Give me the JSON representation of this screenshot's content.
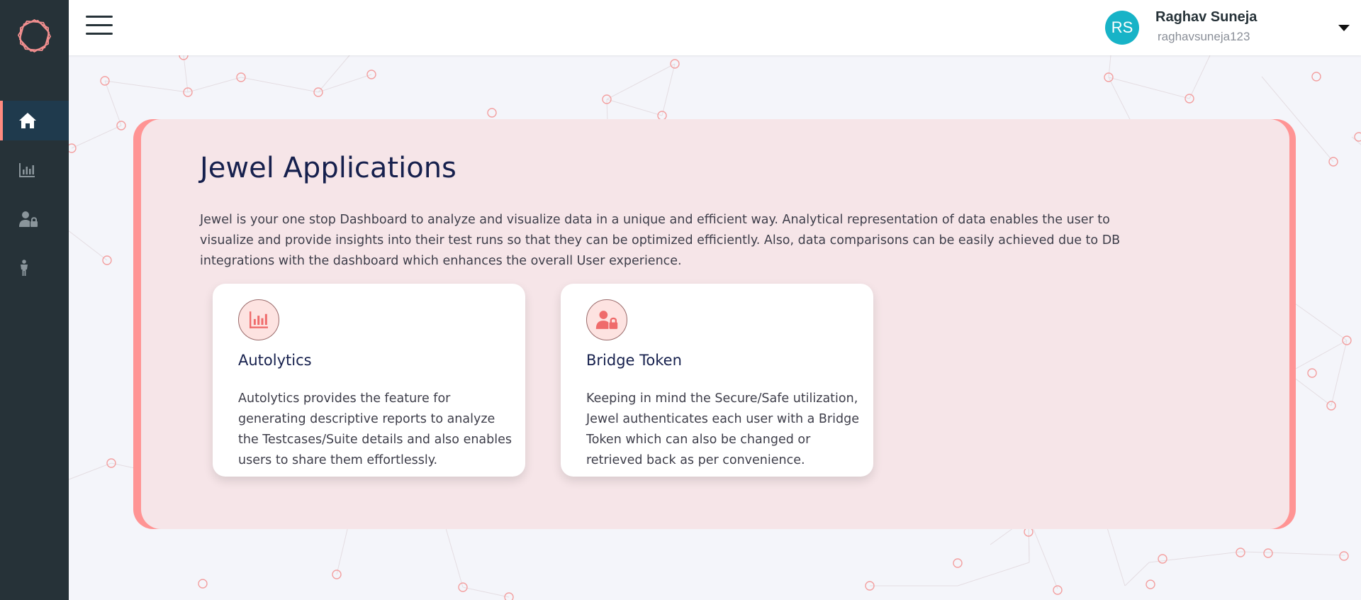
{
  "sidebar": {
    "logo_icon": "hexagon-network-logo-icon",
    "items": [
      {
        "icon": "home-icon",
        "active": true
      },
      {
        "icon": "bar-chart-icon",
        "active": false
      },
      {
        "icon": "user-lock-icon",
        "active": false
      },
      {
        "icon": "person-standing-icon",
        "active": false
      }
    ]
  },
  "header": {
    "menu_icon": "hamburger-menu-icon",
    "user": {
      "initials": "RS",
      "name": "Raghav Suneja",
      "handle": "raghavsuneja123",
      "dropdown_icon": "caret-down-icon"
    }
  },
  "main": {
    "title": "Jewel Applications",
    "description": "Jewel is your one stop Dashboard to analyze and visualize data in a unique and efficient way. Analytical representation of data enables the user to visualize and provide insights into their test runs so that they can be optimized efficiently. Also, data comparisons can be easily achieved due to DB integrations with the dashboard which enhances the overall User experience.",
    "cards": [
      {
        "icon": "bar-chart-icon",
        "title": "Autolytics",
        "description": "Autolytics provides the feature for generating descriptive reports to analyze the Testcases/Suite details and also enables users to share them effortlessly."
      },
      {
        "icon": "user-lock-icon",
        "title": "Bridge Token",
        "description": "Keeping in mind the Secure/Safe utilization, Jewel authenticates each user with a Bridge Token which can also be changed or retrieved back as per convenience."
      }
    ]
  },
  "colors": {
    "sidebar_bg": "#263238",
    "accent": "#ff9494",
    "card_bg": "#f6e5e8",
    "title": "#16204d",
    "avatar": "#17b3c7"
  }
}
